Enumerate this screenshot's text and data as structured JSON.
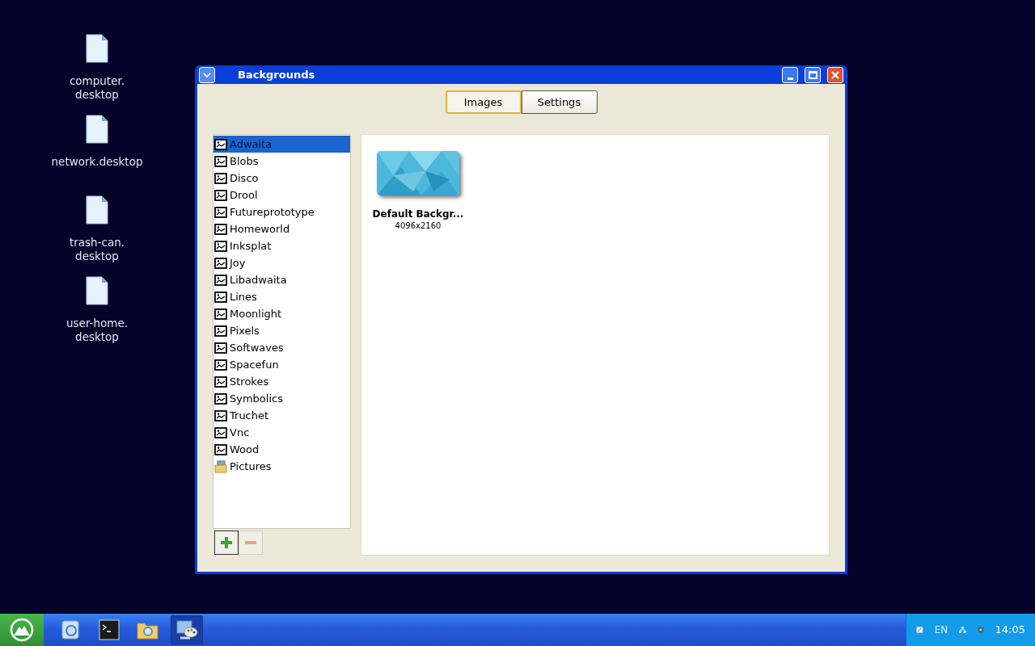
{
  "desktop_icons": [
    {
      "lines": [
        "computer.",
        "desktop"
      ]
    },
    {
      "lines": [
        "network.desktop"
      ]
    },
    {
      "lines": [
        "trash-can.",
        "desktop"
      ]
    },
    {
      "lines": [
        "user-home.",
        "desktop"
      ]
    }
  ],
  "window": {
    "title": "Backgrounds"
  },
  "tabs": [
    {
      "label": "Images",
      "selected": true
    },
    {
      "label": "Settings",
      "selected": false
    }
  ],
  "sidebar": {
    "items": [
      {
        "label": "Adwaita",
        "kind": "theme",
        "selected": true
      },
      {
        "label": "Blobs",
        "kind": "theme",
        "selected": false
      },
      {
        "label": "Disco",
        "kind": "theme",
        "selected": false
      },
      {
        "label": "Drool",
        "kind": "theme",
        "selected": false
      },
      {
        "label": "Futureprototype",
        "kind": "theme",
        "selected": false
      },
      {
        "label": "Homeworld",
        "kind": "theme",
        "selected": false
      },
      {
        "label": "Inksplat",
        "kind": "theme",
        "selected": false
      },
      {
        "label": "Joy",
        "kind": "theme",
        "selected": false
      },
      {
        "label": "Libadwaita",
        "kind": "theme",
        "selected": false
      },
      {
        "label": "Lines",
        "kind": "theme",
        "selected": false
      },
      {
        "label": "Moonlight",
        "kind": "theme",
        "selected": false
      },
      {
        "label": "Pixels",
        "kind": "theme",
        "selected": false
      },
      {
        "label": "Softwaves",
        "kind": "theme",
        "selected": false
      },
      {
        "label": "Spacefun",
        "kind": "theme",
        "selected": false
      },
      {
        "label": "Strokes",
        "kind": "theme",
        "selected": false
      },
      {
        "label": "Symbolics",
        "kind": "theme",
        "selected": false
      },
      {
        "label": "Truchet",
        "kind": "theme",
        "selected": false
      },
      {
        "label": "Vnc",
        "kind": "theme",
        "selected": false
      },
      {
        "label": "Wood",
        "kind": "theme",
        "selected": false
      },
      {
        "label": "Pictures",
        "kind": "folder",
        "selected": false
      }
    ],
    "buttons": [
      {
        "kind": "add",
        "disabled": false
      },
      {
        "kind": "remove",
        "disabled": true
      }
    ]
  },
  "images": [
    {
      "kind": "picture",
      "name": "Default Backgr...",
      "size": "4096x2160"
    }
  ],
  "taskbar": {
    "launchers": [
      {
        "kind": "network",
        "selected": false
      },
      {
        "kind": "terminal",
        "selected": false
      },
      {
        "kind": "folder",
        "selected": false
      },
      {
        "kind": "appearance",
        "selected": true
      }
    ],
    "tray": {
      "language": "EN",
      "clock": "14:05"
    }
  }
}
